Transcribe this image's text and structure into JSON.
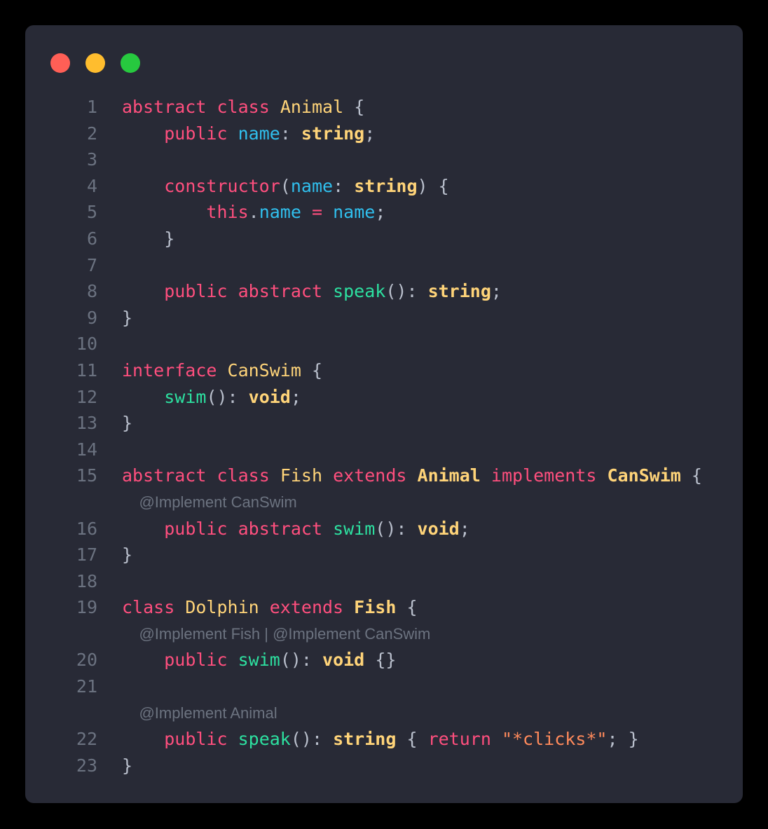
{
  "window": {
    "controls": [
      {
        "name": "close",
        "color": "#FF5F56"
      },
      {
        "name": "minimize",
        "color": "#FFBD2E"
      },
      {
        "name": "maximize",
        "color": "#27C93F"
      }
    ]
  },
  "theme": {
    "page_background": "#000000",
    "card_background": "#282A36",
    "line_number": "#6B7280",
    "keyword": "#FF4F7E",
    "type": "#FFD479",
    "builtin_type": "#FFD479",
    "function": "#2DE0A0",
    "variable": "#30BFED",
    "punctuation": "#B9BFCC",
    "string": "#FF8A5B",
    "annotation": "#6C7380"
  },
  "editor": {
    "language": "typescript",
    "lines": [
      {
        "number": "1",
        "tokens": [
          {
            "t": "abstract",
            "c": "kw"
          },
          {
            "t": " ",
            "c": "plain"
          },
          {
            "t": "class",
            "c": "kw"
          },
          {
            "t": " ",
            "c": "plain"
          },
          {
            "t": "Animal",
            "c": "type"
          },
          {
            "t": " ",
            "c": "plain"
          },
          {
            "t": "{",
            "c": "punc"
          }
        ]
      },
      {
        "number": "2",
        "tokens": [
          {
            "t": "    ",
            "c": "plain"
          },
          {
            "t": "public",
            "c": "kw"
          },
          {
            "t": " ",
            "c": "plain"
          },
          {
            "t": "name",
            "c": "var"
          },
          {
            "t": ": ",
            "c": "punc"
          },
          {
            "t": "string",
            "c": "builtin"
          },
          {
            "t": ";",
            "c": "punc"
          }
        ]
      },
      {
        "number": "3",
        "tokens": []
      },
      {
        "number": "4",
        "tokens": [
          {
            "t": "    ",
            "c": "plain"
          },
          {
            "t": "constructor",
            "c": "kw"
          },
          {
            "t": "(",
            "c": "punc"
          },
          {
            "t": "name",
            "c": "var"
          },
          {
            "t": ": ",
            "c": "punc"
          },
          {
            "t": "string",
            "c": "builtin"
          },
          {
            "t": ")",
            "c": "punc"
          },
          {
            "t": " ",
            "c": "plain"
          },
          {
            "t": "{",
            "c": "punc"
          }
        ]
      },
      {
        "number": "5",
        "tokens": [
          {
            "t": "        ",
            "c": "plain"
          },
          {
            "t": "this",
            "c": "kw"
          },
          {
            "t": ".",
            "c": "punc"
          },
          {
            "t": "name",
            "c": "var"
          },
          {
            "t": " ",
            "c": "plain"
          },
          {
            "t": "=",
            "c": "kw"
          },
          {
            "t": " ",
            "c": "plain"
          },
          {
            "t": "name",
            "c": "var"
          },
          {
            "t": ";",
            "c": "punc"
          }
        ]
      },
      {
        "number": "6",
        "tokens": [
          {
            "t": "    ",
            "c": "plain"
          },
          {
            "t": "}",
            "c": "punc"
          }
        ]
      },
      {
        "number": "7",
        "tokens": []
      },
      {
        "number": "8",
        "tokens": [
          {
            "t": "    ",
            "c": "plain"
          },
          {
            "t": "public",
            "c": "kw"
          },
          {
            "t": " ",
            "c": "plain"
          },
          {
            "t": "abstract",
            "c": "kw"
          },
          {
            "t": " ",
            "c": "plain"
          },
          {
            "t": "speak",
            "c": "fn"
          },
          {
            "t": "(): ",
            "c": "punc"
          },
          {
            "t": "string",
            "c": "builtin"
          },
          {
            "t": ";",
            "c": "punc"
          }
        ]
      },
      {
        "number": "9",
        "tokens": [
          {
            "t": "}",
            "c": "punc"
          }
        ]
      },
      {
        "number": "10",
        "tokens": []
      },
      {
        "number": "11",
        "tokens": [
          {
            "t": "interface",
            "c": "kw"
          },
          {
            "t": " ",
            "c": "plain"
          },
          {
            "t": "CanSwim",
            "c": "type"
          },
          {
            "t": " ",
            "c": "plain"
          },
          {
            "t": "{",
            "c": "punc"
          }
        ]
      },
      {
        "number": "12",
        "tokens": [
          {
            "t": "    ",
            "c": "plain"
          },
          {
            "t": "swim",
            "c": "fn"
          },
          {
            "t": "(): ",
            "c": "punc"
          },
          {
            "t": "void",
            "c": "builtin"
          },
          {
            "t": ";",
            "c": "punc"
          }
        ]
      },
      {
        "number": "13",
        "tokens": [
          {
            "t": "}",
            "c": "punc"
          }
        ]
      },
      {
        "number": "14",
        "tokens": []
      },
      {
        "number": "15",
        "tokens": [
          {
            "t": "abstract",
            "c": "kw"
          },
          {
            "t": " ",
            "c": "plain"
          },
          {
            "t": "class",
            "c": "kw"
          },
          {
            "t": " ",
            "c": "plain"
          },
          {
            "t": "Fish",
            "c": "type"
          },
          {
            "t": " ",
            "c": "plain"
          },
          {
            "t": "extends",
            "c": "kw"
          },
          {
            "t": " ",
            "c": "plain"
          },
          {
            "t": "Animal",
            "c": "type-b"
          },
          {
            "t": " ",
            "c": "plain"
          },
          {
            "t": "implements",
            "c": "kw"
          },
          {
            "t": " ",
            "c": "plain"
          },
          {
            "t": "CanSwim",
            "c": "type-b"
          },
          {
            "t": " ",
            "c": "plain"
          },
          {
            "t": "{",
            "c": "punc"
          }
        ]
      },
      {
        "annotation": "    @Implement CanSwim"
      },
      {
        "number": "16",
        "tokens": [
          {
            "t": "    ",
            "c": "plain"
          },
          {
            "t": "public",
            "c": "kw"
          },
          {
            "t": " ",
            "c": "plain"
          },
          {
            "t": "abstract",
            "c": "kw"
          },
          {
            "t": " ",
            "c": "plain"
          },
          {
            "t": "swim",
            "c": "fn"
          },
          {
            "t": "(): ",
            "c": "punc"
          },
          {
            "t": "void",
            "c": "builtin"
          },
          {
            "t": ";",
            "c": "punc"
          }
        ]
      },
      {
        "number": "17",
        "tokens": [
          {
            "t": "}",
            "c": "punc"
          }
        ]
      },
      {
        "number": "18",
        "tokens": []
      },
      {
        "number": "19",
        "tokens": [
          {
            "t": "class",
            "c": "kw"
          },
          {
            "t": " ",
            "c": "plain"
          },
          {
            "t": "Dolphin",
            "c": "type"
          },
          {
            "t": " ",
            "c": "plain"
          },
          {
            "t": "extends",
            "c": "kw"
          },
          {
            "t": " ",
            "c": "plain"
          },
          {
            "t": "Fish",
            "c": "type-b"
          },
          {
            "t": " ",
            "c": "plain"
          },
          {
            "t": "{",
            "c": "punc"
          }
        ]
      },
      {
        "annotation": "    @Implement Fish | @Implement CanSwim"
      },
      {
        "number": "20",
        "tokens": [
          {
            "t": "    ",
            "c": "plain"
          },
          {
            "t": "public",
            "c": "kw"
          },
          {
            "t": " ",
            "c": "plain"
          },
          {
            "t": "swim",
            "c": "fn"
          },
          {
            "t": "(): ",
            "c": "punc"
          },
          {
            "t": "void",
            "c": "builtin"
          },
          {
            "t": " ",
            "c": "plain"
          },
          {
            "t": "{}",
            "c": "punc"
          }
        ]
      },
      {
        "number": "21",
        "tokens": []
      },
      {
        "annotation": "    @Implement Animal"
      },
      {
        "number": "22",
        "tokens": [
          {
            "t": "    ",
            "c": "plain"
          },
          {
            "t": "public",
            "c": "kw"
          },
          {
            "t": " ",
            "c": "plain"
          },
          {
            "t": "speak",
            "c": "fn"
          },
          {
            "t": "(): ",
            "c": "punc"
          },
          {
            "t": "string",
            "c": "builtin"
          },
          {
            "t": " ",
            "c": "plain"
          },
          {
            "t": "{",
            "c": "punc"
          },
          {
            "t": " ",
            "c": "plain"
          },
          {
            "t": "return",
            "c": "kw"
          },
          {
            "t": " ",
            "c": "plain"
          },
          {
            "t": "\"*clicks*\"",
            "c": "str"
          },
          {
            "t": "; ",
            "c": "punc"
          },
          {
            "t": "}",
            "c": "punc"
          }
        ]
      },
      {
        "number": "23",
        "tokens": [
          {
            "t": "}",
            "c": "punc"
          }
        ]
      }
    ]
  }
}
